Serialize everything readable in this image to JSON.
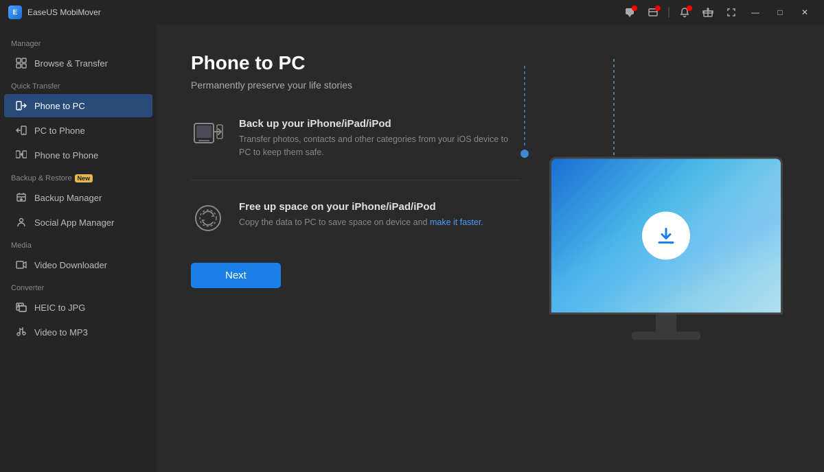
{
  "titleBar": {
    "appName": "EaseUS MobiMover"
  },
  "sidebar": {
    "sections": [
      {
        "label": "Manager",
        "items": [
          {
            "id": "browse-transfer",
            "label": "Browse & Transfer",
            "icon": "grid",
            "active": false
          }
        ]
      },
      {
        "label": "Quick Transfer",
        "items": [
          {
            "id": "phone-to-pc",
            "label": "Phone to PC",
            "icon": "phone-arrow",
            "active": true
          },
          {
            "id": "pc-to-phone",
            "label": "PC to Phone",
            "icon": "pc-arrow",
            "active": false
          },
          {
            "id": "phone-to-phone",
            "label": "Phone to Phone",
            "icon": "phone-phone",
            "active": false
          }
        ]
      },
      {
        "label": "Backup & Restore",
        "badge": "New",
        "items": [
          {
            "id": "backup-manager",
            "label": "Backup Manager",
            "icon": "backup",
            "active": false
          },
          {
            "id": "social-app-manager",
            "label": "Social App Manager",
            "icon": "social",
            "active": false
          }
        ]
      },
      {
        "label": "Media",
        "items": [
          {
            "id": "video-downloader",
            "label": "Video Downloader",
            "icon": "video",
            "active": false
          }
        ]
      },
      {
        "label": "Converter",
        "items": [
          {
            "id": "heic-to-jpg",
            "label": "HEIC to JPG",
            "icon": "image-convert",
            "active": false
          },
          {
            "id": "video-to-mp3",
            "label": "Video to MP3",
            "icon": "audio-convert",
            "active": false
          }
        ]
      }
    ]
  },
  "content": {
    "title": "Phone to PC",
    "subtitle": "Permanently preserve your life stories",
    "features": [
      {
        "id": "backup",
        "title": "Back up your iPhone/iPad/iPod",
        "description": "Transfer photos, contacts and other categories from your iOS device to PC to keep them safe.",
        "highlightDesc": null
      },
      {
        "id": "free-space",
        "title": "Free up space on your iPhone/iPad/iPod",
        "description": "Copy the data to PC to save space on device and make it faster.",
        "highlightDesc": "make it faster."
      }
    ],
    "nextButton": "Next"
  },
  "icons": {
    "minimize": "—",
    "maximize": "□",
    "close": "✕"
  }
}
